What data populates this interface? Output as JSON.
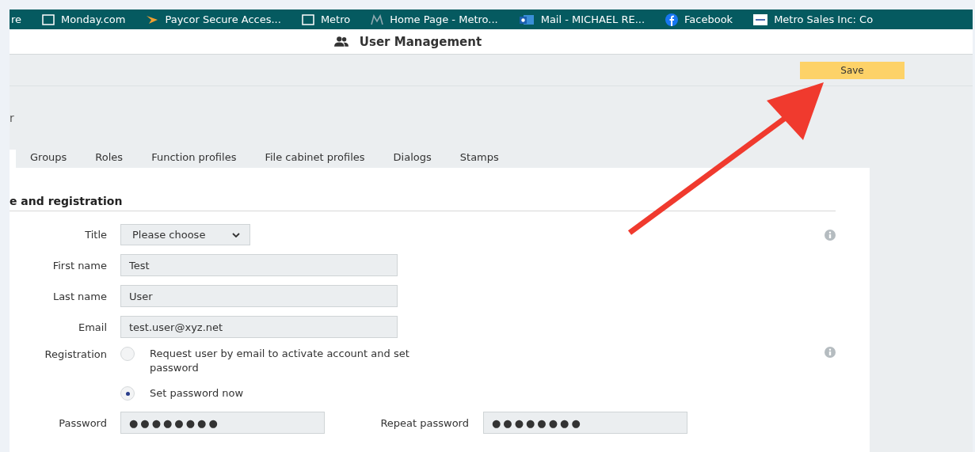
{
  "bookmarks": [
    {
      "label": "re",
      "kind": "plain"
    },
    {
      "label": "Monday.com",
      "kind": "folder"
    },
    {
      "label": "Paycor Secure Acces...",
      "kind": "arrow"
    },
    {
      "label": "Metro",
      "kind": "folder"
    },
    {
      "label": "Home Page - Metro...",
      "kind": "m"
    },
    {
      "label": "Mail - MICHAEL RE...",
      "kind": "mail"
    },
    {
      "label": "Facebook",
      "kind": "facebook"
    },
    {
      "label": "Metro Sales Inc: Co",
      "kind": "msi"
    }
  ],
  "header": {
    "title": "User Management"
  },
  "toolbar": {
    "save": "Save"
  },
  "page_title": "r",
  "tabs": [
    {
      "selected": true
    },
    {
      "label": "Groups",
      "selected": false
    },
    {
      "label": "Roles",
      "selected": false
    },
    {
      "label": "Function profiles",
      "selected": false
    },
    {
      "label": "File cabinet profiles",
      "selected": false
    },
    {
      "label": "Dialogs",
      "selected": false
    },
    {
      "label": "Stamps",
      "selected": false
    }
  ],
  "section": {
    "heading": "e and registration"
  },
  "form": {
    "title": {
      "label": "Title",
      "value": "Please choose"
    },
    "fields": [
      {
        "label": "First name",
        "value": "Test"
      },
      {
        "label": "Last name",
        "value": "User"
      },
      {
        "label": "Email",
        "value": "test.user@xyz.net"
      }
    ],
    "registration": {
      "label": "Registration",
      "options": [
        {
          "label": "Request user by email to activate account and set password",
          "selected": false
        },
        {
          "label": "Set password now",
          "selected": true
        }
      ]
    },
    "password": {
      "label": "Password",
      "value": "●●●●●●●●"
    },
    "repeat_password": {
      "label": "Repeat password",
      "value": "●●●●●●●●"
    }
  }
}
